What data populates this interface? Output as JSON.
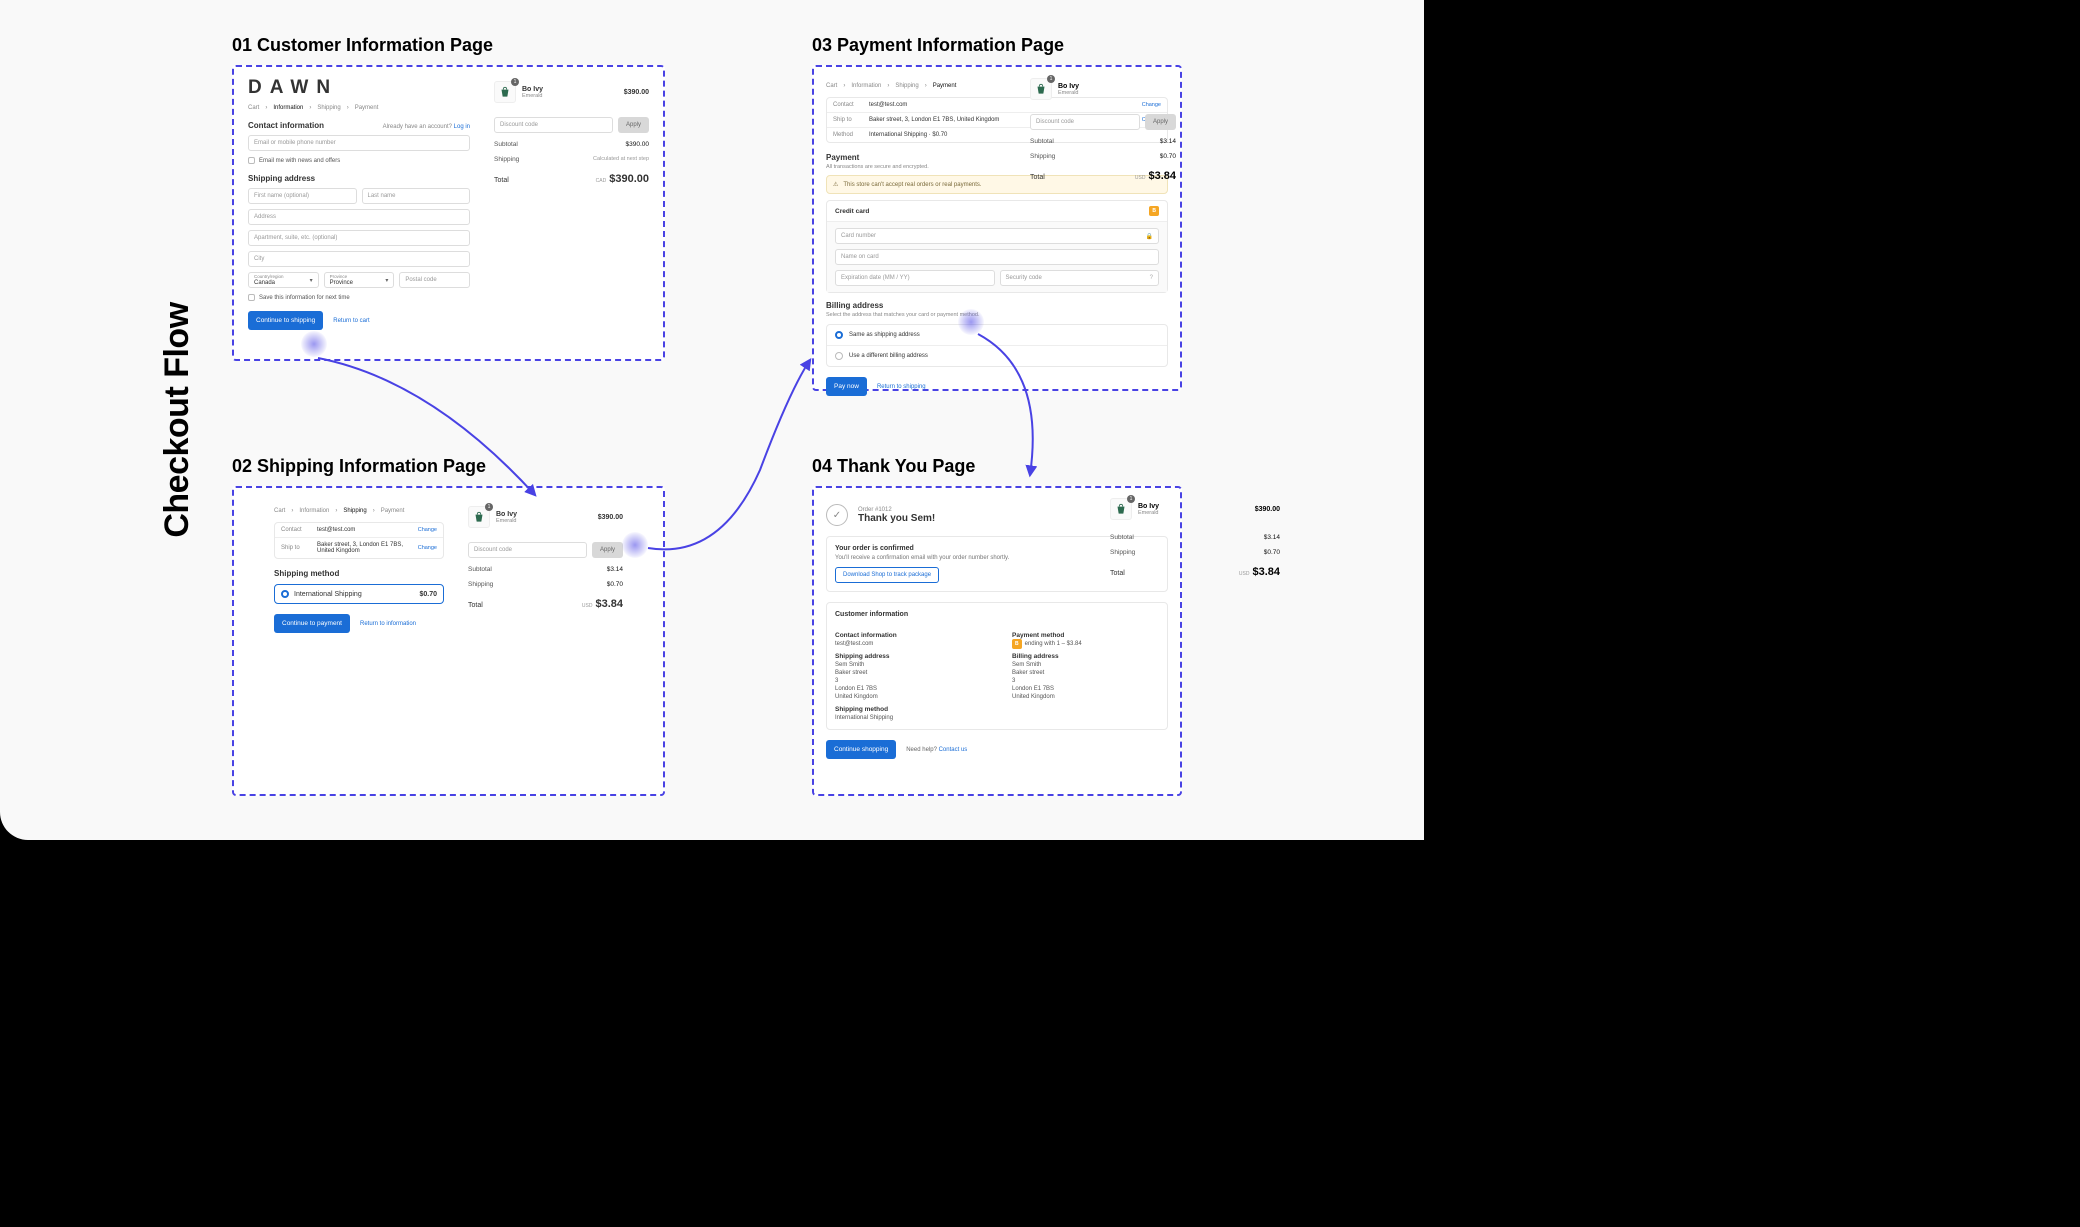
{
  "title": "Checkout Flow",
  "panels": {
    "p1": "01 Customer Information Page",
    "p2": "02 Shipping Information Page",
    "p3": "03 Payment Information Page",
    "p4": "04 Thank You Page"
  },
  "common": {
    "product_name": "Bo Ivy",
    "product_variant": "Emerald",
    "product_price": "$390.00",
    "bag_qty": "1",
    "discount_placeholder": "Discount code",
    "apply": "Apply",
    "subtotal_label": "Subtotal",
    "shipping_label": "Shipping",
    "total_label": "Total",
    "currency": "CAD",
    "usd": "USD"
  },
  "p1": {
    "logo": "DAWN",
    "crumbs": [
      "Cart",
      "Information",
      "Shipping",
      "Payment"
    ],
    "contact_heading": "Contact information",
    "already": "Already have an account?",
    "login": "Log in",
    "email_ph": "Email or mobile phone number",
    "email_chk": "Email me with news and offers",
    "ship_heading": "Shipping address",
    "fn": "First name (optional)",
    "ln": "Last name",
    "addr": "Address",
    "apt": "Apartment, suite, etc. (optional)",
    "city": "City",
    "country_lbl": "Country/region",
    "country_val": "Canada",
    "prov_lbl": "Province",
    "prov_val": "Province",
    "postal": "Postal code",
    "save_chk": "Save this information for next time",
    "continue": "Continue to shipping",
    "back": "Return to cart",
    "subtotal_val": "$390.00",
    "ship_note": "Calculated at next step",
    "total_val": "$390.00"
  },
  "p2": {
    "crumbs": [
      "Cart",
      "Information",
      "Shipping",
      "Payment"
    ],
    "contact_lbl": "Contact",
    "contact_val": "test@test.com",
    "shipto_lbl": "Ship to",
    "shipto_val": "Baker street, 3, London E1 7BS, United Kingdom",
    "change": "Change",
    "ship_method": "Shipping method",
    "ship_opt": "International Shipping",
    "ship_cost": "$0.70",
    "continue": "Continue to payment",
    "back": "Return to information",
    "subtotal_val": "$3.14",
    "total_val": "$3.84"
  },
  "p3": {
    "crumbs": [
      "Cart",
      "Information",
      "Shipping",
      "Payment"
    ],
    "contact_lbl": "Contact",
    "contact_val": "test@test.com",
    "shipto_lbl": "Ship to",
    "shipto_val": "Baker street, 3, London E1 7BS, United Kingdom",
    "method_lbl": "Method",
    "method_val": "International Shipping · $0.70",
    "change": "Change",
    "pay_heading": "Payment",
    "secure": "All transactions are secure and encrypted.",
    "warn": "This store can't accept real orders or real payments.",
    "cc": "Credit card",
    "cardnum": "Card number",
    "cardname": "Name on card",
    "exp": "Expiration date (MM / YY)",
    "cvc": "Security code",
    "bill_heading": "Billing address",
    "bill_sub": "Select the address that matches your card or payment method.",
    "bill_same": "Same as shipping address",
    "bill_diff": "Use a different billing address",
    "pay_btn": "Pay now",
    "back": "Return to shipping",
    "subtotal_val": "$3.14",
    "ship_val": "$0.70",
    "total_val": "$3.84"
  },
  "p4": {
    "order_no": "Order #1012",
    "thanks": "Thank you Sem!",
    "confirmed": "Your order is confirmed",
    "confirm_sub": "You'll receive a confirmation email with your order number shortly.",
    "download": "Download Shop to track package",
    "ci_heading": "Customer information",
    "ci_contact_h": "Contact information",
    "ci_contact_v": "test@test.com",
    "ci_ship_h": "Shipping address",
    "ci_addr_name": "Sem Smith",
    "ci_addr_l1": "Baker street",
    "ci_addr_l2": "3",
    "ci_addr_l3": "London E1 7BS",
    "ci_addr_l4": "United Kingdom",
    "ci_method_h": "Shipping method",
    "ci_method_v": "International Shipping",
    "ci_pay_h": "Payment method",
    "ci_pay_v": "ending with 1 – $3.84",
    "ci_bill_h": "Billing address",
    "continue": "Continue shopping",
    "help": "Need help?",
    "help_link": "Contact us",
    "subtotal_val": "$3.14",
    "ship_val": "$0.70",
    "total_val": "$3.84"
  }
}
